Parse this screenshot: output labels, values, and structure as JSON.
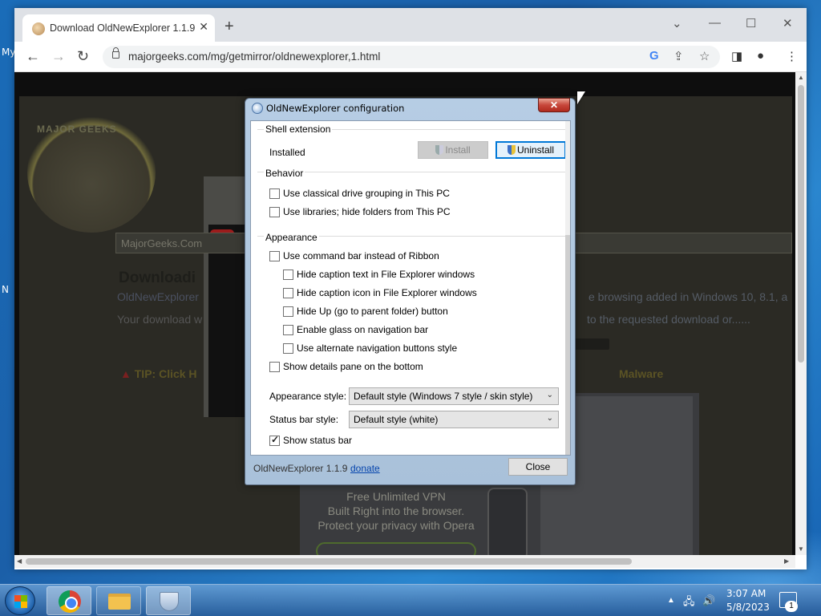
{
  "desktop": {
    "left_labels": [
      "My",
      "N"
    ]
  },
  "browser": {
    "tab_title": "Download OldNewExplorer 1.1.9",
    "tab_close": "✕",
    "new_tab": "+",
    "window_controls": {
      "search_tabs": "⌄",
      "minimize": "—",
      "maximize": "☐",
      "close": "✕"
    },
    "url": "majorgeeks.com/mg/getmirror/oldnewexplorer,1.html"
  },
  "page": {
    "logo_text": "MAJOR GEEKS",
    "search_text": "MajorGeeks.Com",
    "heading": "Downloadi",
    "text1": "OldNewExplorer",
    "text2": "Your download w",
    "text_right1": "e browsing added in Windows 10, 8.1, a",
    "text_right2": "to the requested download or......",
    "tip_label": "TIP: Click H",
    "tip_right": "Malware",
    "ad_lines": [
      "Free Unlimited VPN",
      "Built Right into the browser.",
      "Protect your privacy with Opera"
    ]
  },
  "dialog": {
    "title": "OldNewExplorer configuration",
    "close_glyph": "✕",
    "shell_extension": {
      "label": "Shell extension",
      "status": "Installed",
      "install_button": "Install",
      "uninstall_button": "Uninstall"
    },
    "behavior": {
      "label": "Behavior",
      "options": [
        {
          "label": "Use classical drive grouping in This PC",
          "checked": false
        },
        {
          "label": "Use libraries; hide folders from This PC",
          "checked": false
        }
      ]
    },
    "appearance": {
      "label": "Appearance",
      "options": [
        {
          "label": "Use command bar instead of Ribbon",
          "checked": false,
          "indent": 0
        },
        {
          "label": "Hide caption text in File Explorer windows",
          "checked": false,
          "indent": 1
        },
        {
          "label": "Hide caption icon in File Explorer windows",
          "checked": false,
          "indent": 1
        },
        {
          "label": "Hide Up (go to parent folder) button",
          "checked": false,
          "indent": 1
        },
        {
          "label": "Enable glass on navigation bar",
          "checked": false,
          "indent": 1
        },
        {
          "label": "Use alternate navigation buttons style",
          "checked": false,
          "indent": 1
        },
        {
          "label": "Show details pane on the bottom",
          "checked": false,
          "indent": 0
        }
      ],
      "appearance_style_label": "Appearance style:",
      "appearance_style_value": "Default style (Windows 7 style / skin style)",
      "status_bar_style_label": "Status bar style:",
      "status_bar_style_value": "Default style (white)",
      "show_status_bar": {
        "label": "Show status bar",
        "checked": true
      }
    },
    "footer": {
      "version": "OldNewExplorer 1.1.9",
      "donate_link": "donate",
      "close_button": "Close"
    }
  },
  "taskbar": {
    "time": "3:07 AM",
    "date": "5/8/2023",
    "notification_count": "1"
  }
}
